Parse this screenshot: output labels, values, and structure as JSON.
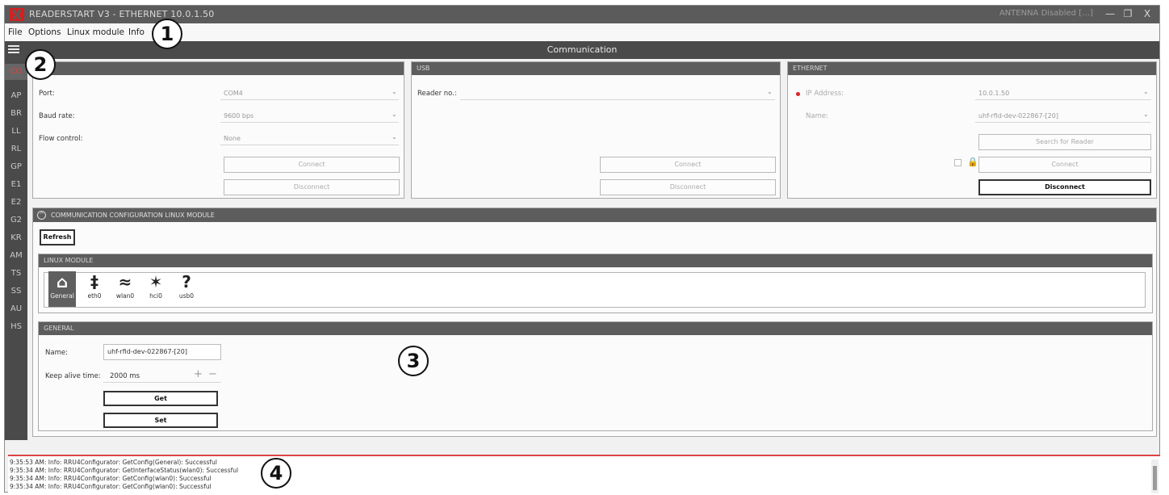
{
  "window": {
    "title": "READERSTART V3 - ETHERNET 10.0.1.50",
    "status": "ANTENNA Disabled […]",
    "minimize": "—",
    "maximize": "❐",
    "close": "X"
  },
  "menu": [
    "File",
    "Options",
    "Linux module",
    "Info"
  ],
  "header": {
    "title": "Communication"
  },
  "sidebar": [
    "CO",
    "AP",
    "BR",
    "LL",
    "RL",
    "GP",
    "E1",
    "E2",
    "G2",
    "KR",
    "AM",
    "TS",
    "SS",
    "AU",
    "HS"
  ],
  "serial": {
    "port_label": "Port:",
    "port_value": "COM4",
    "baud_label": "Baud rate:",
    "baud_value": "9600 bps",
    "flow_label": "Flow control:",
    "flow_value": "None",
    "connect": "Connect",
    "disconnect": "Disconnect"
  },
  "usb": {
    "header": "USB",
    "reader_label": "Reader no.:",
    "connect": "Connect",
    "disconnect": "Disconnect"
  },
  "ethernet": {
    "header": "ETHERNET",
    "ip_label": "IP Address:",
    "ip_value": "10.0.1.50",
    "name_label": "Name:",
    "name_value": "uhf-rfid-dev-022867-[20]",
    "search": "Search for Reader",
    "connect": "Connect",
    "disconnect": "Disconnect"
  },
  "linux_config": {
    "header": "COMMUNICATION CONFIGURATION LINUX MODULE",
    "refresh": "Refresh",
    "module_header": "LINUX MODULE",
    "modules": [
      {
        "label": "General",
        "icon": "home-icon",
        "glyph": "⌂"
      },
      {
        "label": "eth0",
        "icon": "ethernet-plug-icon",
        "glyph": "‡"
      },
      {
        "label": "wlan0",
        "icon": "wifi-icon",
        "glyph": "≈"
      },
      {
        "label": "hci0",
        "icon": "bluetooth-icon",
        "glyph": "✶"
      },
      {
        "label": "usb0",
        "icon": "question-icon",
        "glyph": "?"
      }
    ],
    "general_header": "GENERAL",
    "name_label": "Name:",
    "name_value": "uhf-rfid-dev-022867-[20]",
    "keepalive_label": "Keep alive time:",
    "keepalive_value": "2000 ms",
    "get": "Get",
    "set": "Set"
  },
  "log": [
    "9:35:53 AM: Info: RRU4Configurator: GetConfig(General): Successful",
    "9:35:34 AM: Info: RRU4Configurator: GetInterfaceStatus(wlan0): Successful",
    "9:35:34 AM: Info: RRU4Configurator: GetConfig(wlan0): Successful",
    "9:35:34 AM: Info: RRU4Configurator: GetConfig(wlan0): Successful"
  ],
  "callouts": [
    "1",
    "2",
    "3",
    "4"
  ],
  "colors": {
    "accent": "#d22222",
    "dark": "#4a4a4a"
  }
}
